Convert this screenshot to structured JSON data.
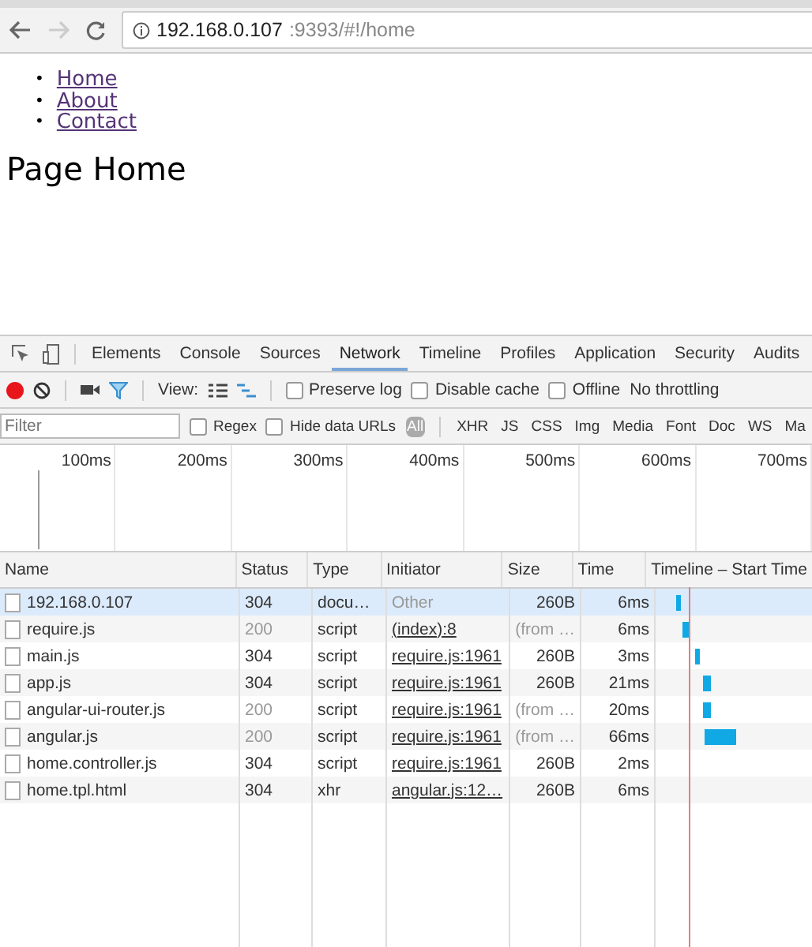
{
  "address_bar": {
    "host": "192.168.0.107",
    "rest": ":9393/#!/home"
  },
  "page": {
    "bullet": "•",
    "nav_links": [
      "Home",
      "About",
      "Contact"
    ],
    "heading": "Page Home"
  },
  "devtools": {
    "tabs": [
      {
        "label": "Elements",
        "selected": false
      },
      {
        "label": "Console",
        "selected": false
      },
      {
        "label": "Sources",
        "selected": false
      },
      {
        "label": "Network",
        "selected": true
      },
      {
        "label": "Timeline",
        "selected": false
      },
      {
        "label": "Profiles",
        "selected": false
      },
      {
        "label": "Application",
        "selected": false
      },
      {
        "label": "Security",
        "selected": false
      },
      {
        "label": "Audits",
        "selected": false
      }
    ],
    "toolbar": {
      "recording": true,
      "view_label": "View:",
      "options": [
        {
          "label": "Preserve log",
          "checked": false
        },
        {
          "label": "Disable cache",
          "checked": false
        },
        {
          "label": "Offline",
          "checked": false
        }
      ],
      "throttling": "No throttling"
    },
    "filter": {
      "placeholder": "Filter",
      "options": [
        {
          "label": "Regex",
          "checked": false
        },
        {
          "label": "Hide data URLs",
          "checked": false
        }
      ],
      "types": [
        {
          "label": "All",
          "selected": true
        },
        {
          "label": "XHR",
          "selected": false
        },
        {
          "label": "JS",
          "selected": false
        },
        {
          "label": "CSS",
          "selected": false
        },
        {
          "label": "Img",
          "selected": false
        },
        {
          "label": "Media",
          "selected": false
        },
        {
          "label": "Font",
          "selected": false
        },
        {
          "label": "Doc",
          "selected": false
        },
        {
          "label": "WS",
          "selected": false
        },
        {
          "label": "Ma",
          "selected": false
        }
      ]
    },
    "overview_ticks": [
      "100ms",
      "200ms",
      "300ms",
      "400ms",
      "500ms",
      "600ms",
      "700ms"
    ],
    "table": {
      "columns": [
        "Name",
        "Status",
        "Type",
        "Initiator",
        "Size",
        "Time",
        "Timeline – Start Time"
      ],
      "rows": [
        {
          "name": "192.168.0.107",
          "status": "304",
          "type": "docu…",
          "initiator": "Other",
          "size": "260B",
          "time": "6ms",
          "selected": true,
          "cached": false
        },
        {
          "name": "require.js",
          "status": "200",
          "type": "script",
          "initiator": "(index):8",
          "size": "(from …",
          "time": "6ms",
          "selected": false,
          "cached": true
        },
        {
          "name": "main.js",
          "status": "304",
          "type": "script",
          "initiator": "require.js:1961",
          "size": "260B",
          "time": "3ms",
          "selected": false,
          "cached": false
        },
        {
          "name": "app.js",
          "status": "304",
          "type": "script",
          "initiator": "require.js:1961",
          "size": "260B",
          "time": "21ms",
          "selected": false,
          "cached": false
        },
        {
          "name": "angular-ui-router.js",
          "status": "200",
          "type": "script",
          "initiator": "require.js:1961",
          "size": "(from …",
          "time": "20ms",
          "selected": false,
          "cached": true
        },
        {
          "name": "angular.js",
          "status": "200",
          "type": "script",
          "initiator": "require.js:1961",
          "size": "(from …",
          "time": "66ms",
          "selected": false,
          "cached": true
        },
        {
          "name": "home.controller.js",
          "status": "304",
          "type": "script",
          "initiator": "require.js:1961",
          "size": "260B",
          "time": "2ms",
          "selected": false,
          "cached": false
        },
        {
          "name": "home.tpl.html",
          "status": "304",
          "type": "xhr",
          "initiator": "angular.js:12…",
          "size": "260B",
          "time": "6ms",
          "selected": false,
          "cached": false
        }
      ]
    }
  }
}
